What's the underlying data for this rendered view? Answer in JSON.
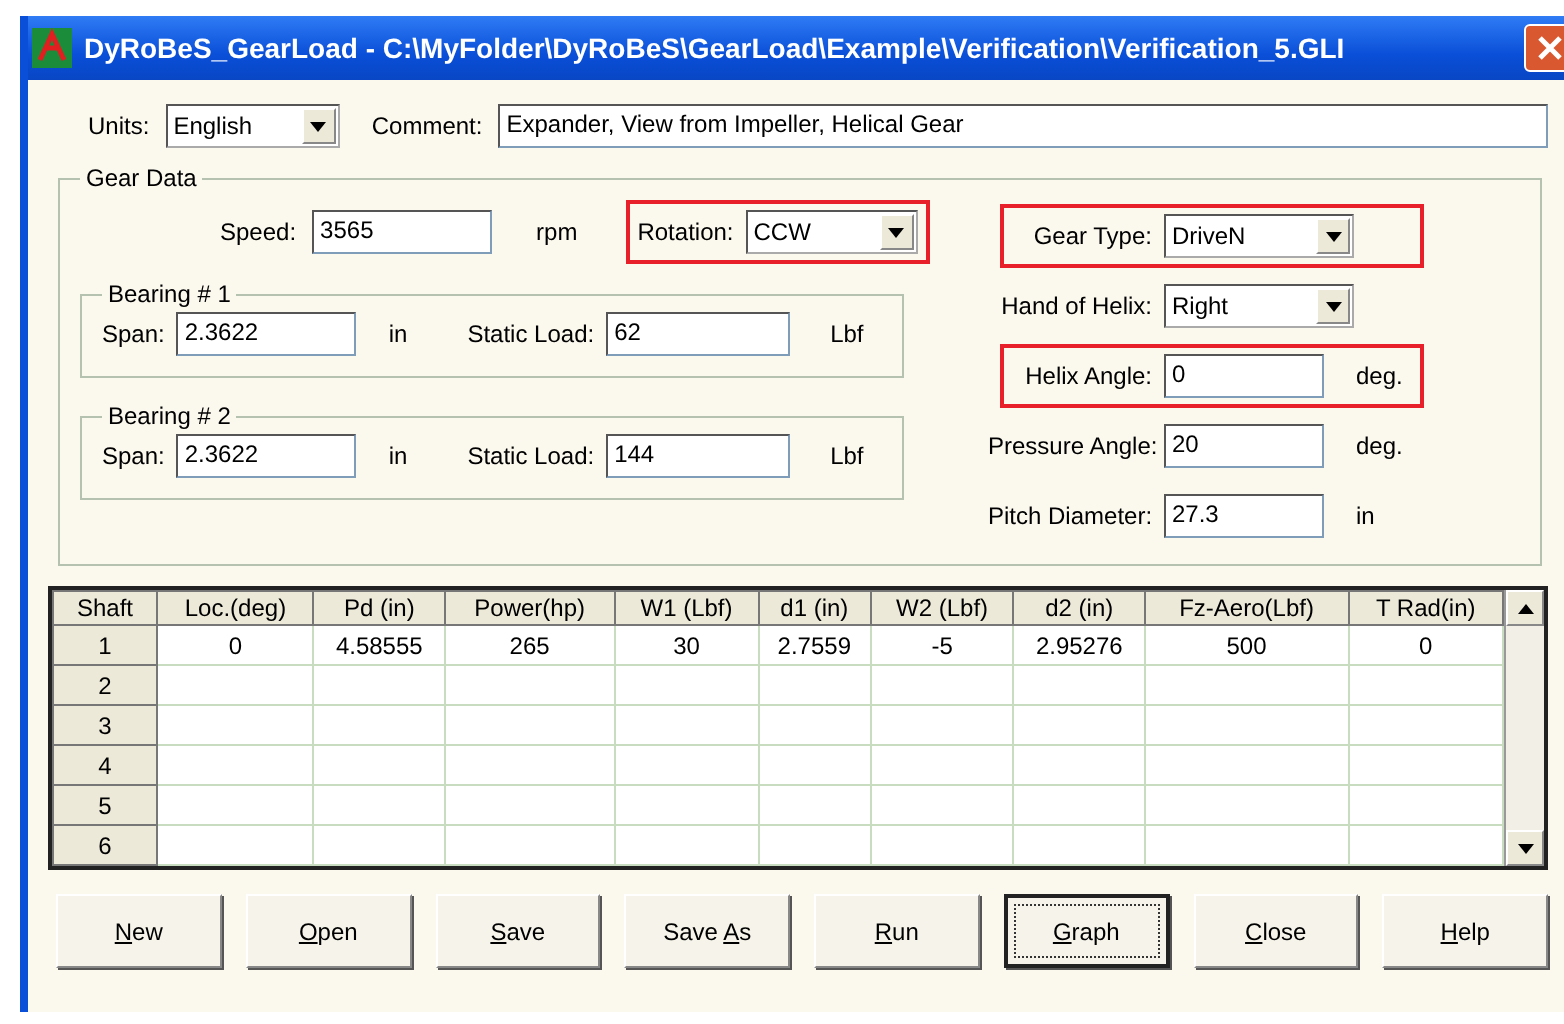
{
  "window": {
    "title": "DyRoBeS_GearLoad - C:\\MyFolder\\DyRoBeS\\GearLoad\\Example\\Verification\\Verification_5.GLI"
  },
  "units": {
    "label": "Units:",
    "value": "English"
  },
  "comment": {
    "label": "Comment:",
    "value": "Expander, View from Impeller, Helical  Gear"
  },
  "gear_data": {
    "title": "Gear Data",
    "speed": {
      "label": "Speed:",
      "value": "3565",
      "unit": "rpm"
    },
    "rotation": {
      "label": "Rotation:",
      "value": "CCW",
      "highlighted": true
    },
    "bearings": [
      {
        "title": "Bearing # 1",
        "span_label": "Span:",
        "span": "2.3622",
        "span_unit": "in",
        "load_label": "Static Load:",
        "load": "62",
        "load_unit": "Lbf"
      },
      {
        "title": "Bearing # 2",
        "span_label": "Span:",
        "span": "2.3622",
        "span_unit": "in",
        "load_label": "Static Load:",
        "load": "144",
        "load_unit": "Lbf"
      }
    ],
    "right_fields": [
      {
        "kind": "combo",
        "label": "Gear Type:",
        "value": "DriveN",
        "highlighted": true
      },
      {
        "kind": "combo",
        "label": "Hand of Helix:",
        "value": "Right",
        "highlighted": false
      },
      {
        "kind": "text",
        "label": "Helix Angle:",
        "value": "0",
        "unit": "deg.",
        "highlighted": true
      },
      {
        "kind": "text",
        "label": "Pressure Angle:",
        "value": "20",
        "unit": "deg.",
        "highlighted": false
      },
      {
        "kind": "text",
        "label": "Pitch Diameter:",
        "value": "27.3",
        "unit": "in",
        "highlighted": false
      }
    ]
  },
  "table": {
    "columns": [
      "Shaft",
      "Loc.(deg)",
      "Pd (in)",
      "Power(hp)",
      "W1 (Lbf)",
      "d1 (in)",
      "W2 (Lbf)",
      "d2 (in)",
      "Fz-Aero(Lbf)",
      "T Rad(in)"
    ],
    "rows": [
      {
        "cells": [
          "1",
          "0",
          "4.58555",
          "265",
          "30",
          "2.7559",
          "-5",
          "2.95276",
          "500",
          "0"
        ]
      },
      {
        "cells": [
          "2",
          "",
          "",
          "",
          "",
          "",
          "",
          "",
          "",
          ""
        ]
      },
      {
        "cells": [
          "3",
          "",
          "",
          "",
          "",
          "",
          "",
          "",
          "",
          ""
        ]
      },
      {
        "cells": [
          "4",
          "",
          "",
          "",
          "",
          "",
          "",
          "",
          "",
          ""
        ]
      },
      {
        "cells": [
          "5",
          "",
          "",
          "",
          "",
          "",
          "",
          "",
          "",
          ""
        ]
      },
      {
        "cells": [
          "6",
          "",
          "",
          "",
          "",
          "",
          "",
          "",
          "",
          ""
        ]
      }
    ]
  },
  "buttons": [
    {
      "key": "N",
      "post": "ew",
      "selected": false
    },
    {
      "key": "O",
      "post": "pen",
      "selected": false
    },
    {
      "key": "S",
      "post": "ave",
      "selected": false
    },
    {
      "pre": "Save ",
      "key": "A",
      "post": "s",
      "selected": false
    },
    {
      "key": "R",
      "post": "un",
      "selected": false
    },
    {
      "key": "G",
      "post": "raph",
      "selected": true
    },
    {
      "key": "C",
      "post": "lose",
      "selected": false
    },
    {
      "key": "H",
      "post": "elp",
      "selected": false
    }
  ]
}
